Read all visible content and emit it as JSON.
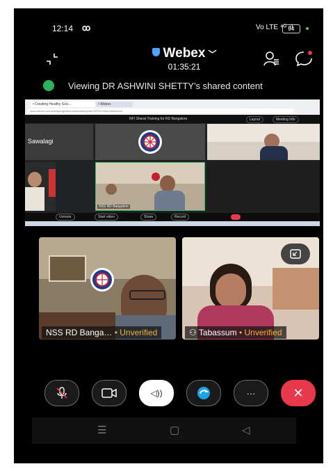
{
  "status_bar": {
    "time": "12:14",
    "infinity": "ꝏ",
    "network": "Vo LTE ⁴ᴳ ᵢıl",
    "battery": "94"
  },
  "header": {
    "app_title": "Webex",
    "chevron": "﹀",
    "timer": "01:35:21"
  },
  "banner": {
    "text": "Viewing DR ASHWINI SHETTY's shared content"
  },
  "shared": {
    "browser_tab": "• Creating Healthy Soci…",
    "browser_tab2": "• Webex",
    "url": "nicsi.webex.com/webappng/sites/nicsi/meeting/info?MTID=m5a24bf3a1bcd",
    "meeting_title": "NFI Sharat Training for RD Bangalore",
    "layout_btn": "Layout",
    "meeting_info_btn": "Meeting Info",
    "tile_name_left": "Sawalagi",
    "tile_label_center": "NSS RD Bangalore",
    "controls": [
      "Unmute",
      "Start video",
      "Share",
      "Record"
    ]
  },
  "video_tiles": [
    {
      "name": "NSS RD Banga…",
      "status": "Unverified"
    },
    {
      "name": "Tabassum",
      "status": "Unverified"
    }
  ],
  "controls": {
    "speaker": "◁))",
    "more": "···",
    "end": "✕"
  },
  "navbar": {
    "menu": "☰",
    "home": "▢",
    "back": "◁"
  },
  "colors": {
    "end_red": "#e8384b",
    "unverified_amber": "#f4b335",
    "webex_blue": "#4aa3ff",
    "signal_green": "#2bb35b"
  }
}
